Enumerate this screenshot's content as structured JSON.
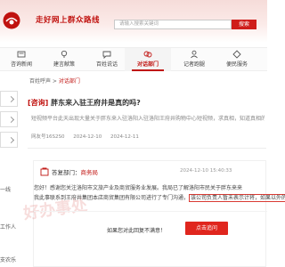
{
  "header": {
    "title": "走好网上群众路线",
    "search_placeholder": "请输入搜索关键词",
    "search_button": "搜索"
  },
  "nav": {
    "items": [
      {
        "label": "咨询新闻",
        "icon": "news-icon",
        "active": false
      },
      {
        "label": "建言献策",
        "icon": "suggestion-icon",
        "active": false
      },
      {
        "label": "百姓说话",
        "icon": "speak-icon",
        "active": false
      },
      {
        "label": "对话部门",
        "icon": "dialogue-icon",
        "active": true
      },
      {
        "label": "记者跑腿",
        "icon": "reporter-icon",
        "active": false
      },
      {
        "label": "便民服务",
        "icon": "service-icon",
        "active": false
      }
    ]
  },
  "left": {
    "texts": [
      "一线",
      "工作人",
      "支农乐"
    ]
  },
  "breadcrumb": {
    "home": "百姓呼声",
    "sep": " > ",
    "current": "对话部门"
  },
  "article": {
    "tag": "[咨询]",
    "title": " 胖东来入驻王府井是真的吗?",
    "summary": "短视频平台此天出现大量关于胖东来入驻洛阳入驻洛阳王府井购物中心短视频，求真相，知道真相的朋友们",
    "meta": [
      "网友号16S2S0",
      "2024-12-10",
      "2024-12-11"
    ]
  },
  "reply": {
    "dept_prefix": "答复部门：",
    "dept_name": "商务局",
    "time": "2024-12-10 15:40:33",
    "line1": "您好！感谢您关注洛阳市文旅产业及商贸服务业发展。我局已了解洛阳市民关于胖东来来",
    "line2_pre": "我此事联系到王府井集团本店商贸集团有限公司进行了专门沟通，",
    "line2_hl": "该公司负责人暂未表示计将，如果以外的知",
    "stamp": "好办事处",
    "satisfy_text": "如果您对此回复不满意！",
    "satisfy_button": "点击追问"
  },
  "colors": {
    "accent": "#c0120f",
    "button": "#e0261e"
  }
}
